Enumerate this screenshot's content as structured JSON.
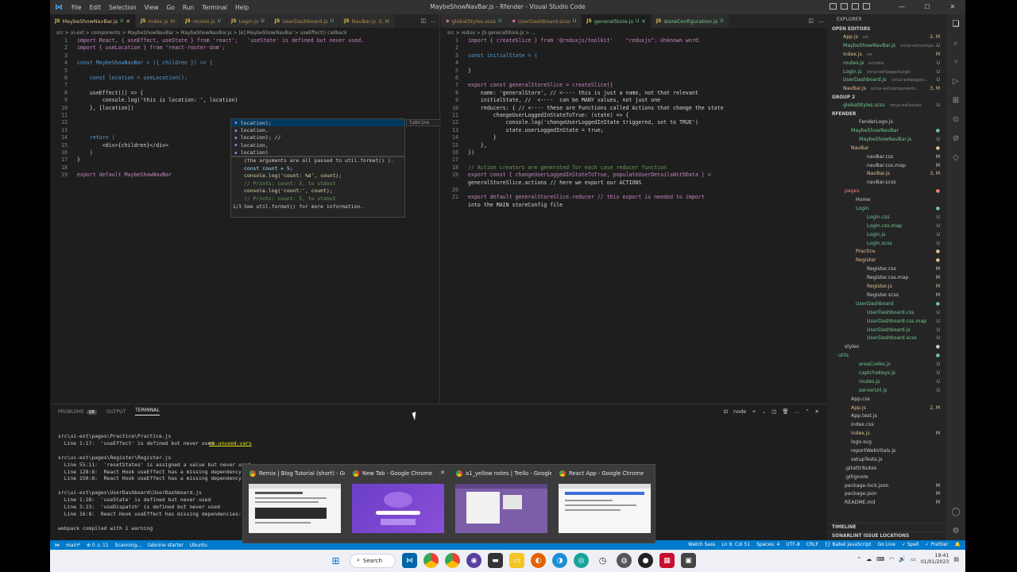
{
  "window": {
    "title": "MaybeShowNavBar.js - Rfender - Visual Studio Code",
    "menu": [
      "File",
      "Edit",
      "Selection",
      "View",
      "Go",
      "Run",
      "Terminal",
      "Help"
    ]
  },
  "editor_left": {
    "tabs": [
      {
        "label": "MaybeShowNavBar.js",
        "status": "U",
        "active": true
      },
      {
        "label": "index.js",
        "status": "M"
      },
      {
        "label": "routes.js",
        "status": "U"
      },
      {
        "label": "Login.js",
        "status": "U"
      },
      {
        "label": "UserDashboard.js",
        "status": "U"
      },
      {
        "label": "NavBar.js",
        "status": "3, M"
      }
    ],
    "breadcrumb": "src > ui-ext > components > MaybeShowNavBar > MaybeShowNavBar.js > [e] MaybeShowNavBar > useEffect() callback",
    "lines": [
      {
        "n": "1",
        "code": "import React, { useEffect, useState } from 'react';   'useState' is defined but never used."
      },
      {
        "n": "2",
        "code": "import { useLocation } from 'react-router-dom';"
      },
      {
        "n": "3",
        "code": ""
      },
      {
        "n": "4",
        "code": "const MaybeShowNavBar = ({ children }) => {"
      },
      {
        "n": "5",
        "code": ""
      },
      {
        "n": "6",
        "code": "    const location = useLocation();"
      },
      {
        "n": "7",
        "code": ""
      },
      {
        "n": "8",
        "code": "    useEffect(() => {"
      },
      {
        "n": "9",
        "code": "        console.log('this is location: ', location)"
      },
      {
        "n": "10",
        "code": "    }, [location])"
      },
      {
        "n": "11",
        "code": ""
      },
      {
        "n": "12",
        "code": ""
      },
      {
        "n": "13",
        "code": ""
      },
      {
        "n": "14",
        "code": "    return ("
      },
      {
        "n": "15",
        "code": "        <div>{children}</div>"
      },
      {
        "n": "16",
        "code": "    )"
      },
      {
        "n": "17",
        "code": "}"
      },
      {
        "n": "18",
        "code": ""
      },
      {
        "n": "19",
        "code": "export default MaybeShowNavBar"
      }
    ],
    "suggest": [
      "location);",
      "location.",
      "location); //",
      "location,",
      "location)"
    ],
    "suggest_source": "tabnine",
    "param_hint": [
      "(the arguments are all passed to  util.format() ).",
      "",
      "const count = 5;",
      "console.log('count: %d', count);",
      "// Prints: count: 5, to stdout",
      "console.log('count:', count);",
      "// Prints: count: 5, to stdout",
      "See  util.format()  for more information."
    ],
    "param_page": "1/3"
  },
  "editor_right": {
    "tabs": [
      {
        "label": "globalStyles.scss",
        "status": "U"
      },
      {
        "label": "UserDashboard.scss",
        "status": "U"
      },
      {
        "label": "generalStore.js",
        "status": "U",
        "active": true
      },
      {
        "label": "storeConfiguration.js",
        "status": "U"
      }
    ],
    "breadcrumb": "src > redux > JS generalStore.js > ...",
    "lines": [
      {
        "n": "1",
        "code": "import { createSlice } from '@reduxjs/toolkit'    \"reduxjs\": Unknown word."
      },
      {
        "n": "2",
        "code": ""
      },
      {
        "n": "3",
        "code": "const initialState = {"
      },
      {
        "n": "4",
        "code": ""
      },
      {
        "n": "5",
        "code": "}"
      },
      {
        "n": "6",
        "code": ""
      },
      {
        "n": "7",
        "code": "export const generalStoreSlice = createSlice({"
      },
      {
        "n": "8",
        "code": "    name: 'generalStore', // <---- this is just a name, not that relevant"
      },
      {
        "n": "9",
        "code": "    initialState, //  <----  can be MANY values, not just one"
      },
      {
        "n": "10",
        "code": "    reducers: { // <---- these are Functions called Actions that change the state"
      },
      {
        "n": "11",
        "code": "        changeUserLoggedInStateToTrue: (state) => {"
      },
      {
        "n": "12",
        "code": "            console.log('changeUserLoggedInState triggered, set to TRUE')"
      },
      {
        "n": "13",
        "code": "            state.userLoggedInState = true;"
      },
      {
        "n": "14",
        "code": "        }"
      },
      {
        "n": "15",
        "code": "    },"
      },
      {
        "n": "16",
        "code": "})"
      },
      {
        "n": "17",
        "code": ""
      },
      {
        "n": "18",
        "code": "// Action creators are generated for each case reducer function"
      },
      {
        "n": "19",
        "code": "export const { changeUserLoggedInStateToTrue, populateUserDetailsWithData } ="
      },
      {
        "n": "",
        "code": "generalStoreSlice.actions // here we export our ACTIONS"
      },
      {
        "n": "20",
        "code": ""
      },
      {
        "n": "21",
        "code": "export default generalStoreSlice.reducer // this export is needed to import"
      },
      {
        "n": "",
        "code": "into the MAIN storeConfig file"
      }
    ]
  },
  "panel": {
    "tabs": [
      "PROBLEMS",
      "OUTPUT",
      "TERMINAL"
    ],
    "problems_count": "18",
    "active": "TERMINAL",
    "shell": "node",
    "terminal_lines": [
      "src\\ui-ext\\pages\\Practice\\Practice.js",
      "  Line 1:17:  'useEffect' is defined but never used  ",
      "",
      "src\\ui-ext\\pages\\Register\\Register.js",
      "  Line 55:11:  'resetStates' is assigned a value but never used",
      "  Line 128:8:  React Hook useEffect has a missing dependency: 'p",
      "  Line 150:8:  React Hook useEffect has a missing dependency: 'n",
      "",
      "src\\ui-ext\\pages\\UserDashboard\\UserDashboard.js",
      "  Line 1:28:  'useState' is defined but never used",
      "  Line 3:23:  'useDispatch' is defined but never used",
      "  Line 16:8:  React Hook useEffect has missing dependencies: 'us",
      "",
      "webpack compiled with 1 warning"
    ],
    "rule": "no-unused-vars"
  },
  "sidebar": {
    "header": "EXPLORER",
    "open_editors": "OPEN EDITORS",
    "group2": "GROUP 2",
    "root": "RFENDER",
    "timeline": "TIMELINE",
    "sonarlint": "SONARLINT ISSUE LOCATIONS"
  },
  "status_bar": {
    "left": [
      "main*",
      "⊗ 0 ⚠ 11",
      "Scanning...",
      "tabnine starter",
      "Ubuntu"
    ],
    "right": [
      "Watch Sass",
      "Ln 9, Col 51",
      "Spaces: 4",
      "UTF-8",
      "CRLF",
      "{} Babel JavaScript",
      "Go Live",
      "✓ Spell",
      "✓ Prettier"
    ]
  },
  "alt_tab": [
    {
      "title": "Remix | Blog Tutorial (short) - Google Chrome"
    },
    {
      "title": "New Tab - Google Chrome"
    },
    {
      "title": "a1_yellow notes | Trello - Google Chrome"
    },
    {
      "title": "React App - Google Chrome"
    }
  ],
  "taskbar": {
    "search": "Search",
    "time": "19:41",
    "date": "01/01/2023"
  }
}
